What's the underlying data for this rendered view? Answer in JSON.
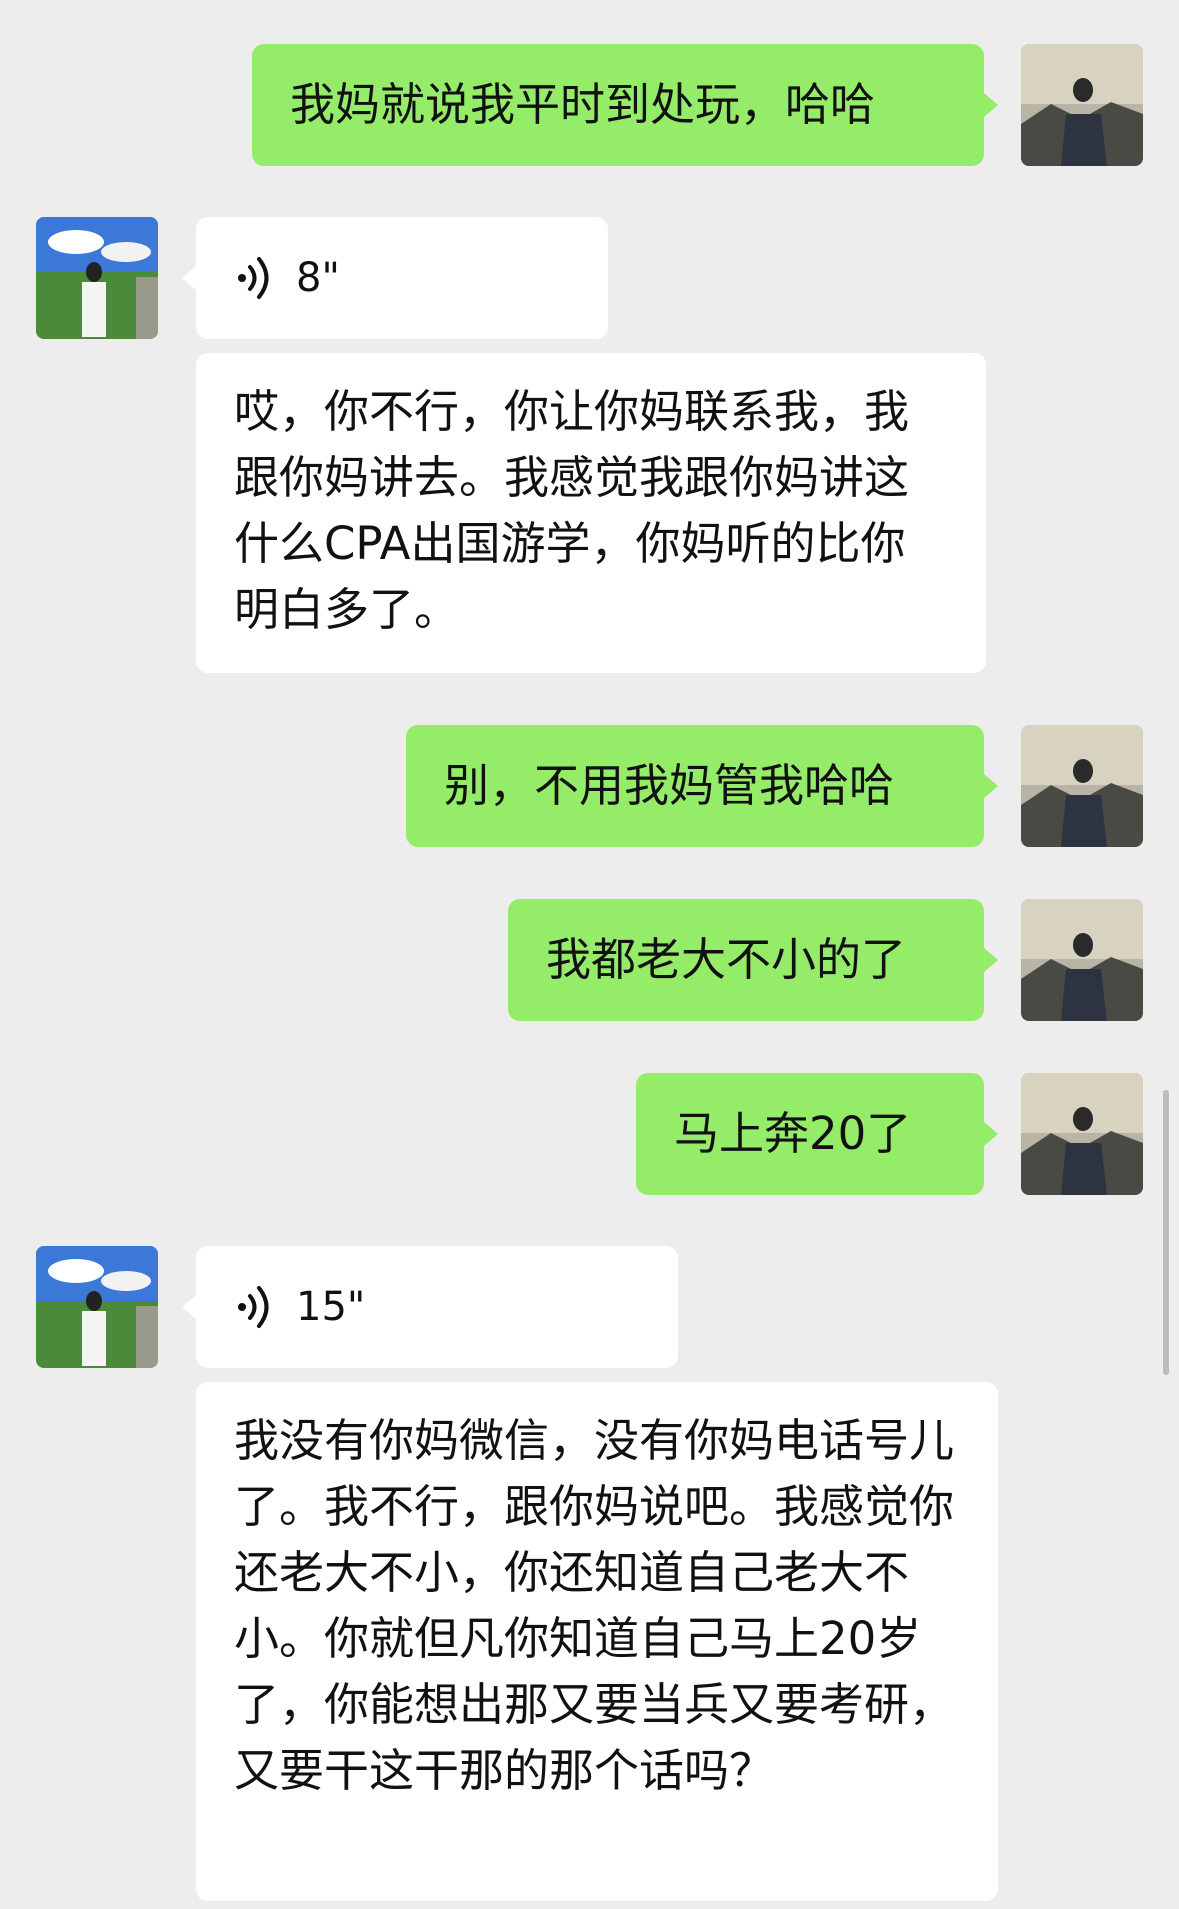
{
  "messages": [
    {
      "side": "right",
      "type": "text",
      "text": "我妈就说我平时到处玩，哈哈"
    },
    {
      "side": "left",
      "type": "voice",
      "duration": "8\""
    },
    {
      "side": "left",
      "type": "text",
      "text": "哎，你不行，你让你妈联系我，我跟你妈讲去。我感觉我跟你妈讲这什么CPA出国游学，你妈听的比你明白多了。"
    },
    {
      "side": "right",
      "type": "text",
      "text": "别，不用我妈管我哈哈"
    },
    {
      "side": "right",
      "type": "text",
      "text": "我都老大不小的了"
    },
    {
      "side": "right",
      "type": "text",
      "text": "马上奔20了"
    },
    {
      "side": "left",
      "type": "voice",
      "duration": "15\""
    },
    {
      "side": "left",
      "type": "text",
      "text": "我没有你妈微信，没有你妈电话号儿了。我不行，跟你妈说吧。我感觉你还老大不小，你还知道自己老大不小。你就但凡你知道自己马上20岁了，你能想出那又要当兵又要考研，又要干这干那的那个话吗？"
    }
  ],
  "colors": {
    "background": "#ededed",
    "outgoing_bubble": "#95ec69",
    "incoming_bubble": "#ffffff"
  }
}
